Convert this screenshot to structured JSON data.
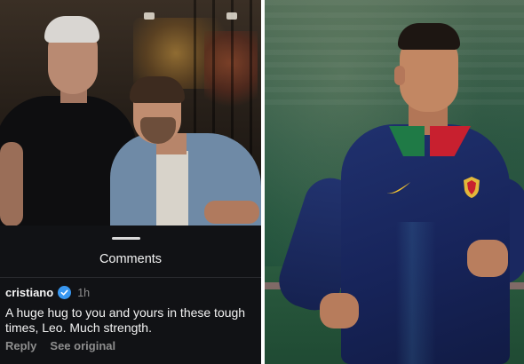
{
  "comments_sheet": {
    "title": "Comments",
    "comment": {
      "username": "cristiano",
      "verified": true,
      "timestamp": "1h",
      "text": "A huge hug to you and yours in these tough times, Leo. Much strength.",
      "actions": [
        "Reply",
        "See original"
      ]
    }
  },
  "colors": {
    "sheet_background": "#111215",
    "verified_badge": "#3897f0",
    "secondary_text": "#8e8e8e",
    "primary_text": "#f2f2f2"
  },
  "icons": {
    "verified": "verified-badge-icon",
    "swoosh": "nike-swoosh-icon",
    "crest": "portugal-crest-icon"
  }
}
